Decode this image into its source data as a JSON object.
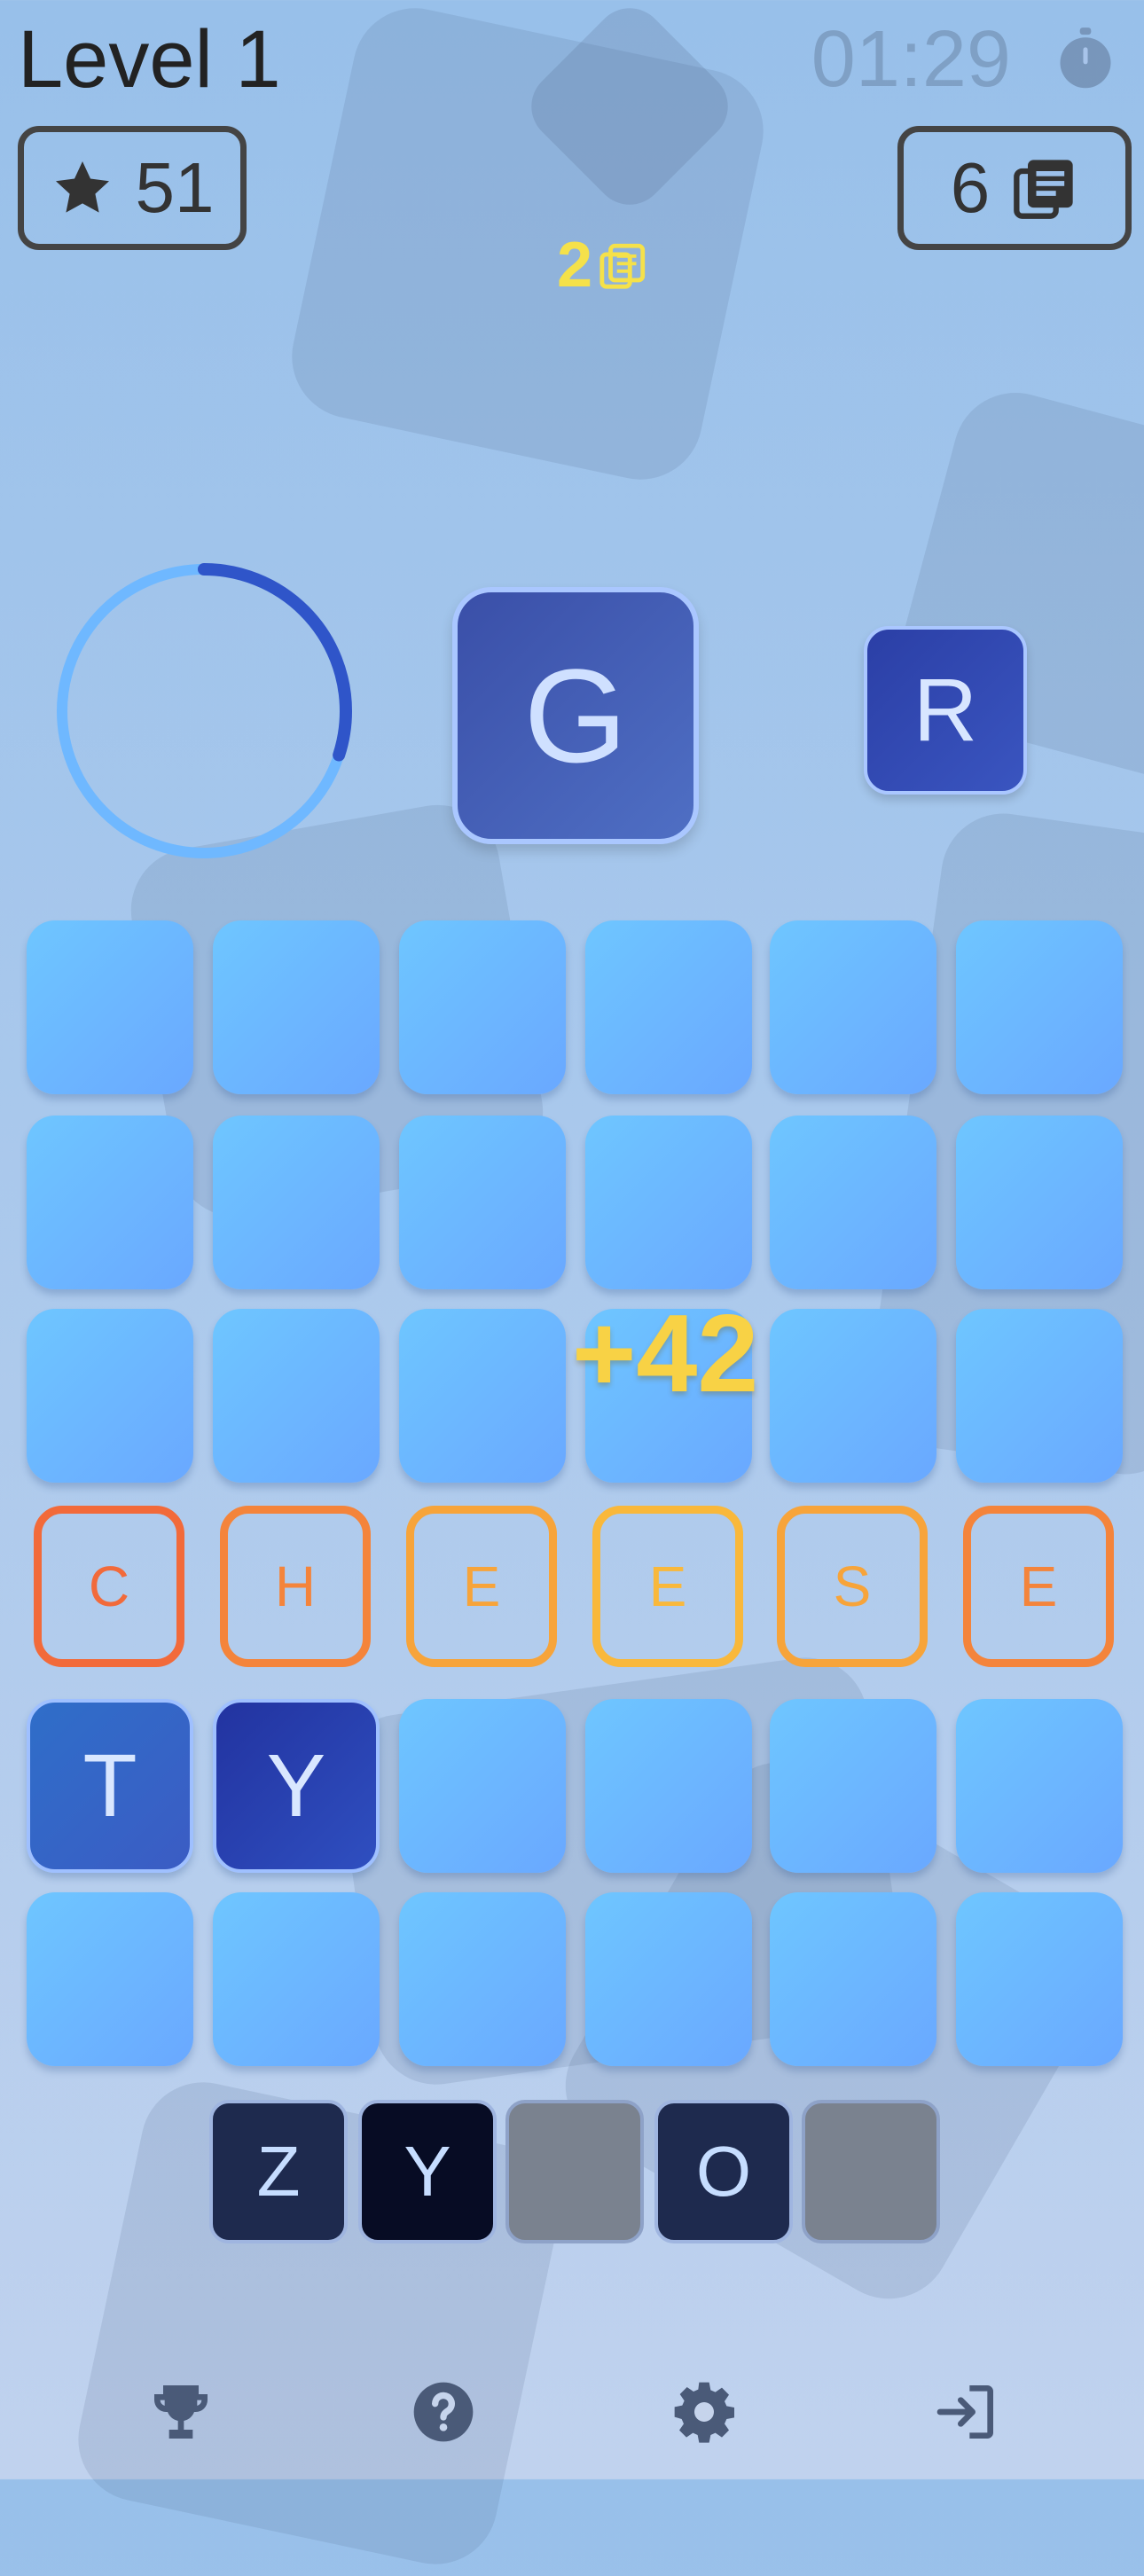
{
  "header": {
    "level_label": "Level 1",
    "timer": "01:29",
    "stars": "51",
    "decks": "6",
    "bonus_decks": "2"
  },
  "current_letter": "G",
  "next_letter": "R",
  "progress_ring": {
    "fraction": 0.3
  },
  "score_popup": "+42",
  "grid": [
    [
      "",
      "",
      "",
      "",
      "",
      ""
    ],
    [
      "",
      "",
      "",
      "",
      "",
      ""
    ],
    [
      "",
      "",
      "",
      "",
      "",
      ""
    ],
    [
      "C",
      "H",
      "E",
      "E",
      "S",
      "E"
    ],
    [
      "T",
      "Y",
      "",
      "",
      "",
      ""
    ],
    [
      "",
      "",
      "",
      "",
      "",
      ""
    ]
  ],
  "word_colors": [
    "#f26a3a",
    "#f4843b",
    "#f7a43a",
    "#f9b83b",
    "#f7a43a",
    "#f4843b"
  ],
  "pick_letters": [
    "Z",
    "Y",
    "",
    "O",
    ""
  ],
  "nav": [
    "trophy-icon",
    "help-icon",
    "settings-icon",
    "exit-icon"
  ]
}
